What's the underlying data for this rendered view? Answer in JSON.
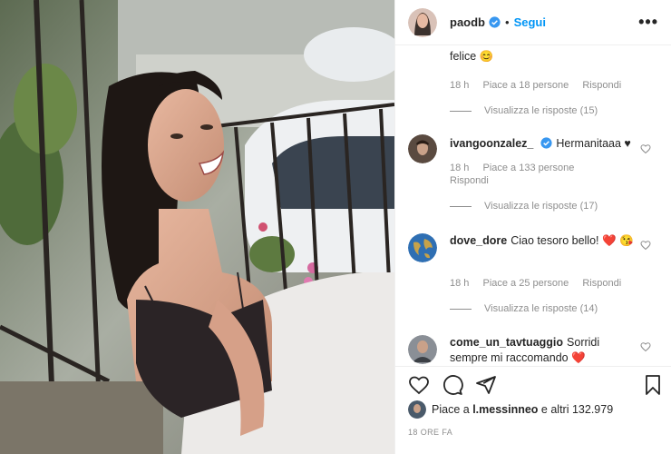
{
  "post": {
    "username": "paodb",
    "follow_label": "Segui",
    "dot": "•",
    "more_label": "•••",
    "likes_prefix": "Piace a",
    "likes_user": "l.messinneo",
    "likes_suffix": "e altri 132.979",
    "time_ago": "18 ORE FA"
  },
  "comments": [
    {
      "username": "",
      "text": "felice 😊",
      "time": "18 h",
      "likes": "Piace a 18 persone",
      "reply": "Rispondi",
      "view_replies": "Visualizza le risposte (15)"
    },
    {
      "username": "ivangoonzalez_",
      "text": "Hermanitaaa ♥",
      "time": "18 h",
      "likes": "Piace a 133 persone",
      "reply": "Rispondi",
      "view_replies": "Visualizza le risposte (17)"
    },
    {
      "username": "dove_dore",
      "text": "Ciao tesoro bello! ❤️ 😘",
      "time": "18 h",
      "likes": "Piace a 25 persone",
      "reply": "Rispondi",
      "view_replies": "Visualizza le risposte (14)"
    },
    {
      "username": "come_un_tavtuaggio",
      "text": "Sorridi sempre mi raccomando ❤️"
    }
  ],
  "colors": {
    "link": "#0095f6",
    "muted": "#8e8e8e",
    "text": "#262626"
  }
}
